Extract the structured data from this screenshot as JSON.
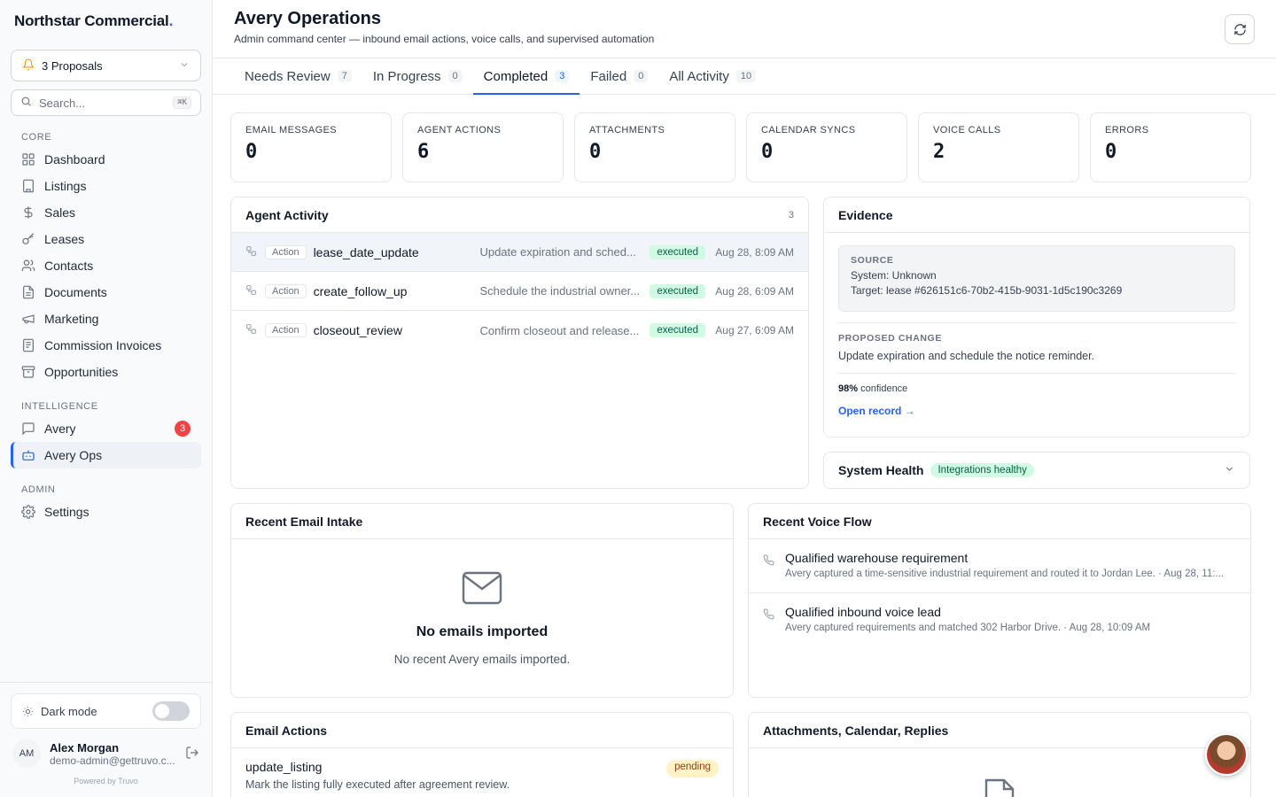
{
  "brand": {
    "name": "Northstar Commercial",
    "dot": "."
  },
  "proposals": {
    "label": "3 Proposals"
  },
  "search": {
    "placeholder": "Search...",
    "shortcut": "⌘K"
  },
  "sidebar": {
    "sections": {
      "core": "CORE",
      "intelligence": "INTELLIGENCE",
      "admin": "ADMIN"
    },
    "core": [
      "Dashboard",
      "Listings",
      "Sales",
      "Leases",
      "Contacts",
      "Documents",
      "Marketing",
      "Commission Invoices",
      "Opportunities"
    ],
    "intelligence": [
      {
        "label": "Avery",
        "badge": "3"
      },
      {
        "label": "Avery Ops"
      }
    ],
    "admin": [
      "Settings"
    ],
    "dark_mode": "Dark mode",
    "user": {
      "initials": "AM",
      "name": "Alex Morgan",
      "email": "demo-admin@gettruvo.c..."
    },
    "powered": "Powered by Truvo"
  },
  "header": {
    "title": "Avery Operations",
    "subtitle": "Admin command center — inbound email actions, voice calls, and supervised automation"
  },
  "tabs": [
    {
      "label": "Needs Review",
      "count": "7"
    },
    {
      "label": "In Progress",
      "count": "0"
    },
    {
      "label": "Completed",
      "count": "3"
    },
    {
      "label": "Failed",
      "count": "0"
    },
    {
      "label": "All Activity",
      "count": "10"
    }
  ],
  "stats": [
    {
      "label": "EMAIL MESSAGES",
      "value": "0"
    },
    {
      "label": "AGENT ACTIONS",
      "value": "6"
    },
    {
      "label": "ATTACHMENTS",
      "value": "0"
    },
    {
      "label": "CALENDAR SYNCS",
      "value": "0"
    },
    {
      "label": "VOICE CALLS",
      "value": "2"
    },
    {
      "label": "ERRORS",
      "value": "0"
    }
  ],
  "activity": {
    "title": "Agent Activity",
    "count": "3",
    "rows": [
      {
        "tag": "Action",
        "name": "lease_date_update",
        "desc": "Update expiration and sched...",
        "status": "executed",
        "time": "Aug 28, 8:09 AM"
      },
      {
        "tag": "Action",
        "name": "create_follow_up",
        "desc": "Schedule the industrial owner...",
        "status": "executed",
        "time": "Aug 28, 6:09 AM"
      },
      {
        "tag": "Action",
        "name": "closeout_review",
        "desc": "Confirm closeout and release...",
        "status": "executed",
        "time": "Aug 27, 6:09 AM"
      }
    ]
  },
  "evidence": {
    "title": "Evidence",
    "source_label": "SOURCE",
    "system": "System: Unknown",
    "target": "Target: lease #626151c6-70b2-415b-9031-1d5c190c3269",
    "proposed_label": "PROPOSED CHANGE",
    "proposed_text": "Update expiration and schedule the notice reminder.",
    "confidence_value": "98%",
    "confidence_label": "confidence",
    "open_record": "Open record →"
  },
  "health": {
    "title": "System Health",
    "status": "Integrations healthy"
  },
  "email_intake": {
    "title": "Recent Email Intake",
    "empty_title": "No emails imported",
    "empty_sub": "No recent Avery emails imported."
  },
  "voice_flow": {
    "title": "Recent Voice Flow",
    "rows": [
      {
        "title": "Qualified warehouse requirement",
        "sub": "Avery captured a time-sensitive industrial requirement and routed it to Jordan Lee. · Aug 28, 11:..."
      },
      {
        "title": "Qualified inbound voice lead",
        "sub": "Avery captured requirements and matched 302 Harbor Drive. · Aug 28, 10:09 AM"
      }
    ]
  },
  "email_actions": {
    "title": "Email Actions",
    "rows": [
      {
        "name": "update_listing",
        "desc": "Mark the listing fully executed after agreement review.",
        "status": "pending"
      }
    ]
  },
  "attachments": {
    "title": "Attachments, Calendar, Replies"
  },
  "colors": {
    "accent": "#2563eb",
    "success_bg": "#d1fae5",
    "warning_bg": "#fef3c7",
    "danger": "#ef4444"
  }
}
